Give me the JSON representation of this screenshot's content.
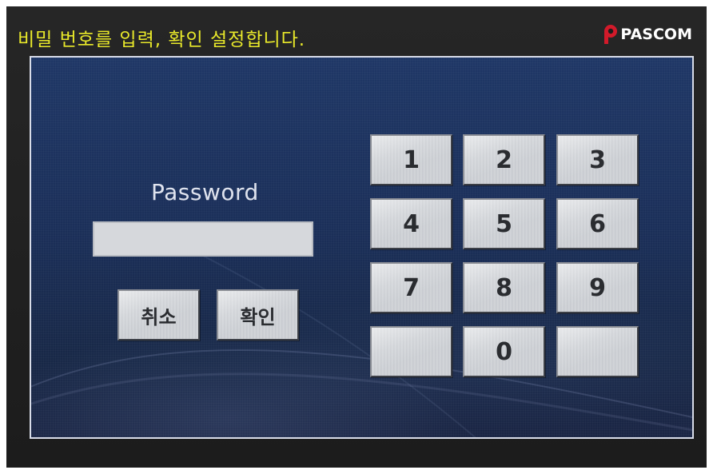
{
  "header": {
    "instruction": "비밀 번호를 입력, 확인 설정합니다.",
    "logo_text": "PASCOM"
  },
  "form": {
    "password_label": "Password",
    "password_value": "",
    "cancel_label": "취소",
    "confirm_label": "확인"
  },
  "keypad": {
    "keys": [
      "1",
      "2",
      "3",
      "4",
      "5",
      "6",
      "7",
      "8",
      "9",
      "",
      "0",
      ""
    ]
  },
  "colors": {
    "instruction_text": "#e9e92a",
    "logo_accent": "#d21a2a",
    "panel_background": "#1f3766",
    "button_face": "#c8cbd0"
  }
}
